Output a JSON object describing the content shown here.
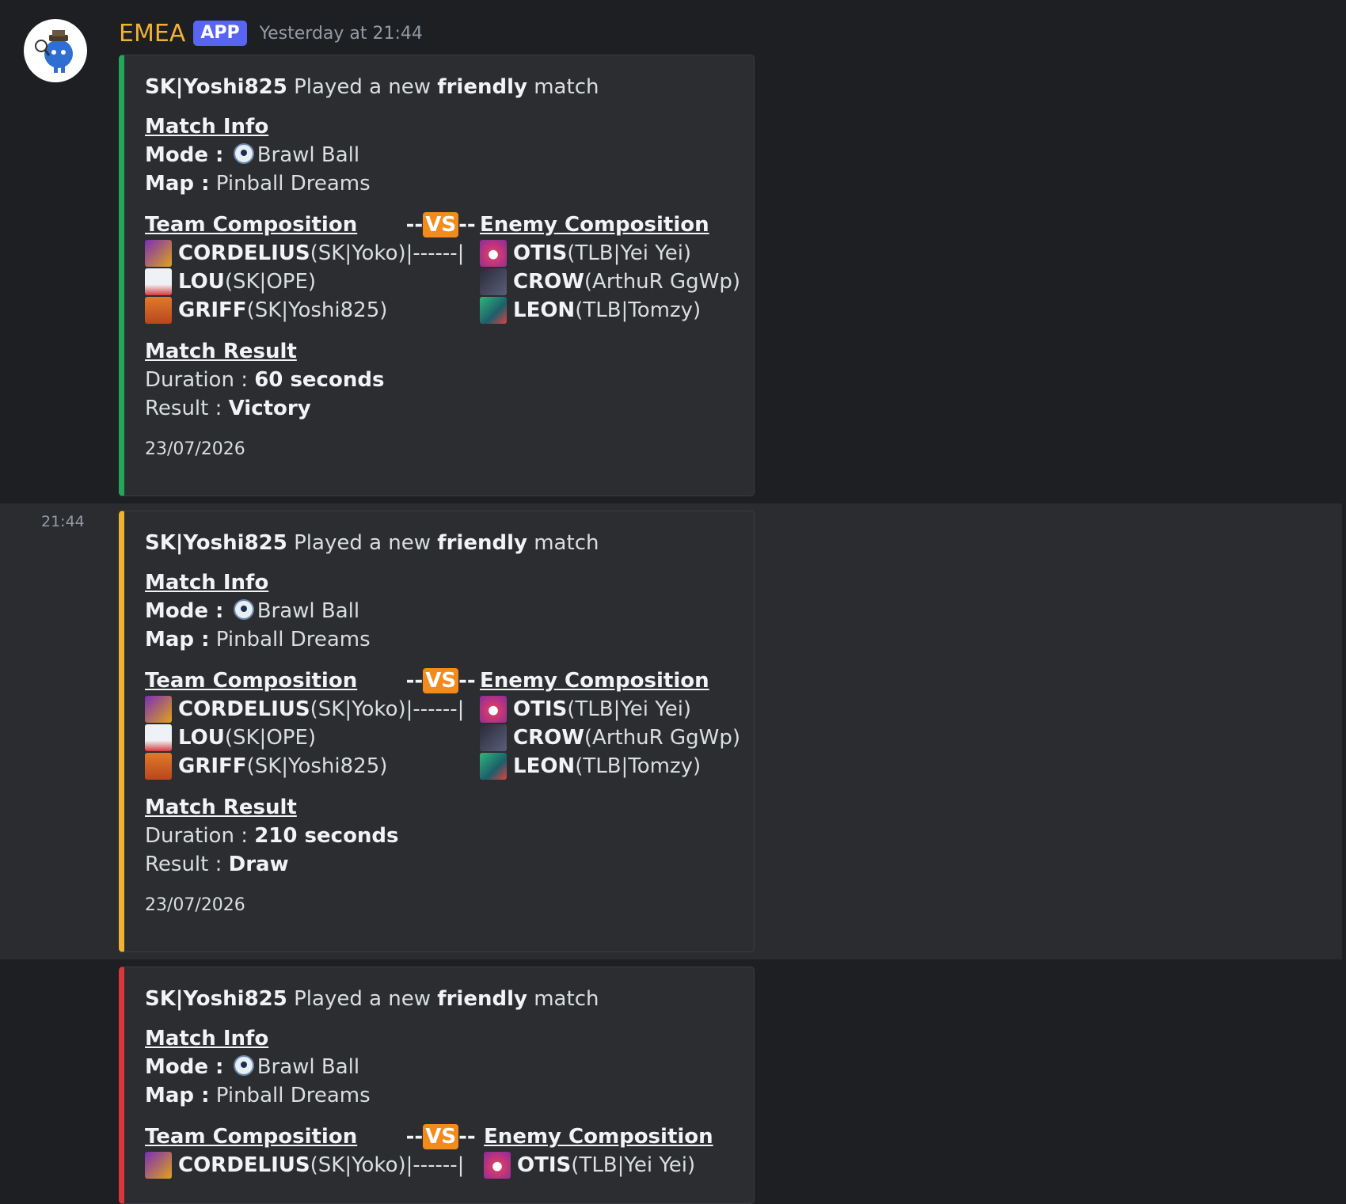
{
  "author": {
    "name": "EMEA",
    "badge": "APP",
    "timestamp": "Yesterday at 21:44"
  },
  "side_time": "21:44",
  "colors": {
    "victory": "#23a55a",
    "draw": "#f0b232",
    "defeat": "#da373c",
    "author": "#f0b232",
    "badge": "#5865f2"
  },
  "embed_common": {
    "player": "SK|Yoshi825",
    "played_text": " Played a new ",
    "match_type": "friendly",
    "match_word": " match",
    "match_info_title": "Match Info",
    "mode_label": "Mode :",
    "mode_icon": "soccer-ball-icon",
    "mode_value": "Brawl Ball",
    "map_label": "Map :",
    "map_value": "Pinball Dreams",
    "team_title": "Team Composition",
    "vs_left": "--",
    "vs_text": "VS",
    "vs_right": "--",
    "divider": "|------|",
    "enemy_title": "Enemy Composition",
    "team": [
      {
        "brawler": "CORDELIUS",
        "player": " (SK|Yoko)",
        "icon": "cordelius-icon"
      },
      {
        "brawler": "LOU",
        "player": " (SK|OPE)",
        "icon": "lou-icon"
      },
      {
        "brawler": "GRIFF",
        "player": " (SK|Yoshi825)",
        "icon": "griff-icon"
      }
    ],
    "enemy": [
      {
        "brawler": "OTIS",
        "player": " (TLB|Yei Yei)",
        "icon": "otis-icon"
      },
      {
        "brawler": "CROW",
        "player": " (ArthuR GgWp)",
        "icon": "crow-icon"
      },
      {
        "brawler": "LEON",
        "player": " (TLB|Tomzy)",
        "icon": "leon-icon"
      }
    ],
    "result_title": "Match Result",
    "duration_label": "Duration : ",
    "result_label": "Result : ",
    "date": "23/07/2026"
  },
  "embeds": [
    {
      "duration": "60 seconds",
      "result": "Victory"
    },
    {
      "duration": "210 seconds",
      "result": "Draw"
    },
    {
      "duration": "",
      "result": ""
    }
  ]
}
